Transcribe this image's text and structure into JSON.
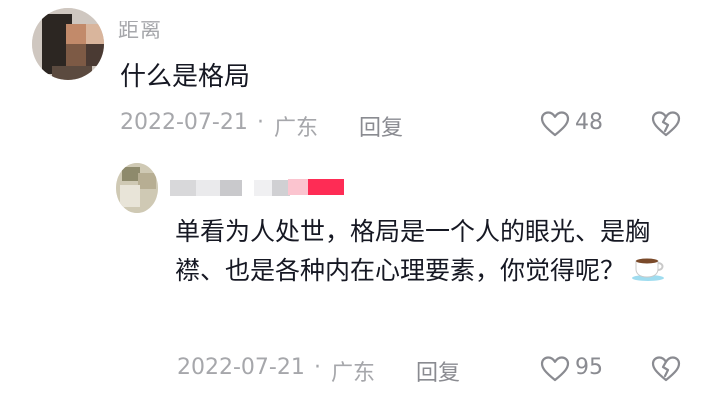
{
  "comment1": {
    "author": "距离",
    "text": "什么是格局",
    "date": "2022-07-21",
    "location_sep": "·",
    "location": "广东",
    "reply_label": "回复",
    "likes": "48"
  },
  "comment2": {
    "text": "单看为人处世，格局是一个人的眼光、是胸襟、也是各种内在心理要素，你觉得呢？",
    "date": "2022-07-21",
    "location_sep": "·",
    "location": "广东",
    "reply_label": "回复",
    "likes": "95",
    "emoji": "hot-beverage-icon"
  },
  "colors": {
    "secondary_text": "#a6a7ab",
    "badge_pink": "#fe2c55"
  }
}
